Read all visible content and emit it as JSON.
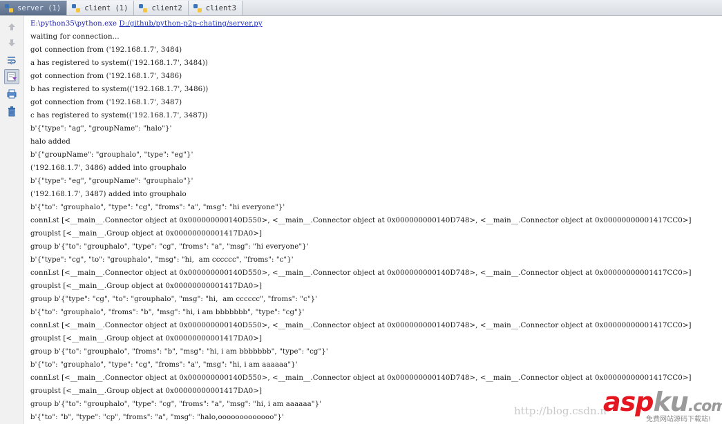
{
  "tabs": [
    {
      "label": "server (1)",
      "active": true
    },
    {
      "label": "client (1)",
      "active": false
    },
    {
      "label": "client2",
      "active": false
    },
    {
      "label": "client3",
      "active": false
    }
  ],
  "toolbar": [
    "up-arrow-icon",
    "down-arrow-icon",
    "soft-wrap-icon",
    "scroll-to-end-icon",
    "print-icon",
    "trash-icon"
  ],
  "console": {
    "command_prefix": "E:\\python35\\python.exe ",
    "command_link": "D:/github/python-p2p-chating/server.py",
    "lines": [
      "waiting for connection...",
      "got connection from ('192.168.1.7', 3484)",
      "a has registered to system(('192.168.1.7', 3484))",
      "got connection from ('192.168.1.7', 3486)",
      "b has registered to system(('192.168.1.7', 3486))",
      "got connection from ('192.168.1.7', 3487)",
      "c has registered to system(('192.168.1.7', 3487))",
      "b'{\"type\": \"ag\", \"groupName\": \"halo\"}'",
      "halo added",
      "b'{\"groupName\": \"grouphalo\", \"type\": \"eg\"}'",
      "('192.168.1.7', 3486) added into grouphalo",
      "b'{\"type\": \"eg\", \"groupName\": \"grouphalo\"}'",
      "('192.168.1.7', 3487) added into grouphalo",
      "b'{\"to\": \"grouphalo\", \"type\": \"cg\", \"froms\": \"a\", \"msg\": \"hi everyone\"}'",
      "connLst [<__main__.Connector object at 0x000000000140D550>, <__main__.Connector object at 0x000000000140D748>, <__main__.Connector object at 0x00000000001417CC0>]",
      "grouplst [<__main__.Group object at 0x00000000001417DA0>]",
      "group b'{\"to\": \"grouphalo\", \"type\": \"cg\", \"froms\": \"a\", \"msg\": \"hi everyone\"}'",
      "b'{\"type\": \"cg\", \"to\": \"grouphalo\", \"msg\": \"hi,  am cccccc\", \"froms\": \"c\"}'",
      "connLst [<__main__.Connector object at 0x000000000140D550>, <__main__.Connector object at 0x000000000140D748>, <__main__.Connector object at 0x00000000001417CC0>]",
      "grouplst [<__main__.Group object at 0x00000000001417DA0>]",
      "group b'{\"type\": \"cg\", \"to\": \"grouphalo\", \"msg\": \"hi,  am cccccc\", \"froms\": \"c\"}'",
      "b'{\"to\": \"grouphalo\", \"froms\": \"b\", \"msg\": \"hi, i am bbbbbbb\", \"type\": \"cg\"}'",
      "connLst [<__main__.Connector object at 0x000000000140D550>, <__main__.Connector object at 0x000000000140D748>, <__main__.Connector object at 0x00000000001417CC0>]",
      "grouplst [<__main__.Group object at 0x00000000001417DA0>]",
      "group b'{\"to\": \"grouphalo\", \"froms\": \"b\", \"msg\": \"hi, i am bbbbbbb\", \"type\": \"cg\"}'",
      "b'{\"to\": \"grouphalo\", \"type\": \"cg\", \"froms\": \"a\", \"msg\": \"hi, i am aaaaaa\"}'",
      "connLst [<__main__.Connector object at 0x000000000140D550>, <__main__.Connector object at 0x000000000140D748>, <__main__.Connector object at 0x00000000001417CC0>]",
      "grouplst [<__main__.Group object at 0x00000000001417DA0>]",
      "group b'{\"to\": \"grouphalo\", \"type\": \"cg\", \"froms\": \"a\", \"msg\": \"hi, i am aaaaaa\"}'",
      "b'{\"to\": \"b\", \"type\": \"cp\", \"froms\": \"a\", \"msg\": \"halo,ooooooooooooo\"}'"
    ]
  },
  "watermark": {
    "url": "http://blog.csdn.n",
    "logo_red": "asp",
    "logo_gray": "ku",
    "logo_com": ".com",
    "sub": "免费网站源码下载站!"
  }
}
